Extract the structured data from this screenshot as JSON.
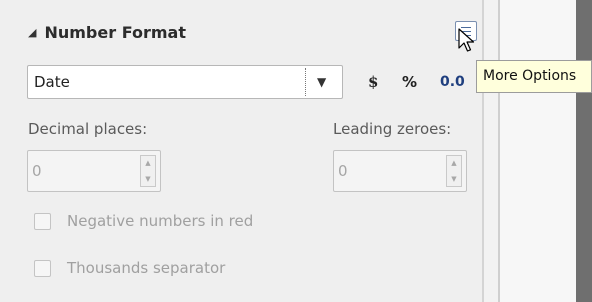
{
  "panel": {
    "section_title": "Number Format",
    "collapse_icon": "triangle-down-icon",
    "more_options_icon": "more-options-icon",
    "tooltip": "More Options"
  },
  "format": {
    "category_selected": "Date",
    "currency_label": "$",
    "percent_label": "%",
    "decimal_label": "0.0"
  },
  "options": {
    "decimal_places_label": "Decimal places:",
    "decimal_places_value": "0",
    "leading_zeroes_label": "Leading zeroes:",
    "leading_zeroes_value": "0",
    "negative_red_label": "Negative numbers in red",
    "negative_red_checked": false,
    "thousands_sep_label": "Thousands separator",
    "thousands_sep_checked": false
  }
}
